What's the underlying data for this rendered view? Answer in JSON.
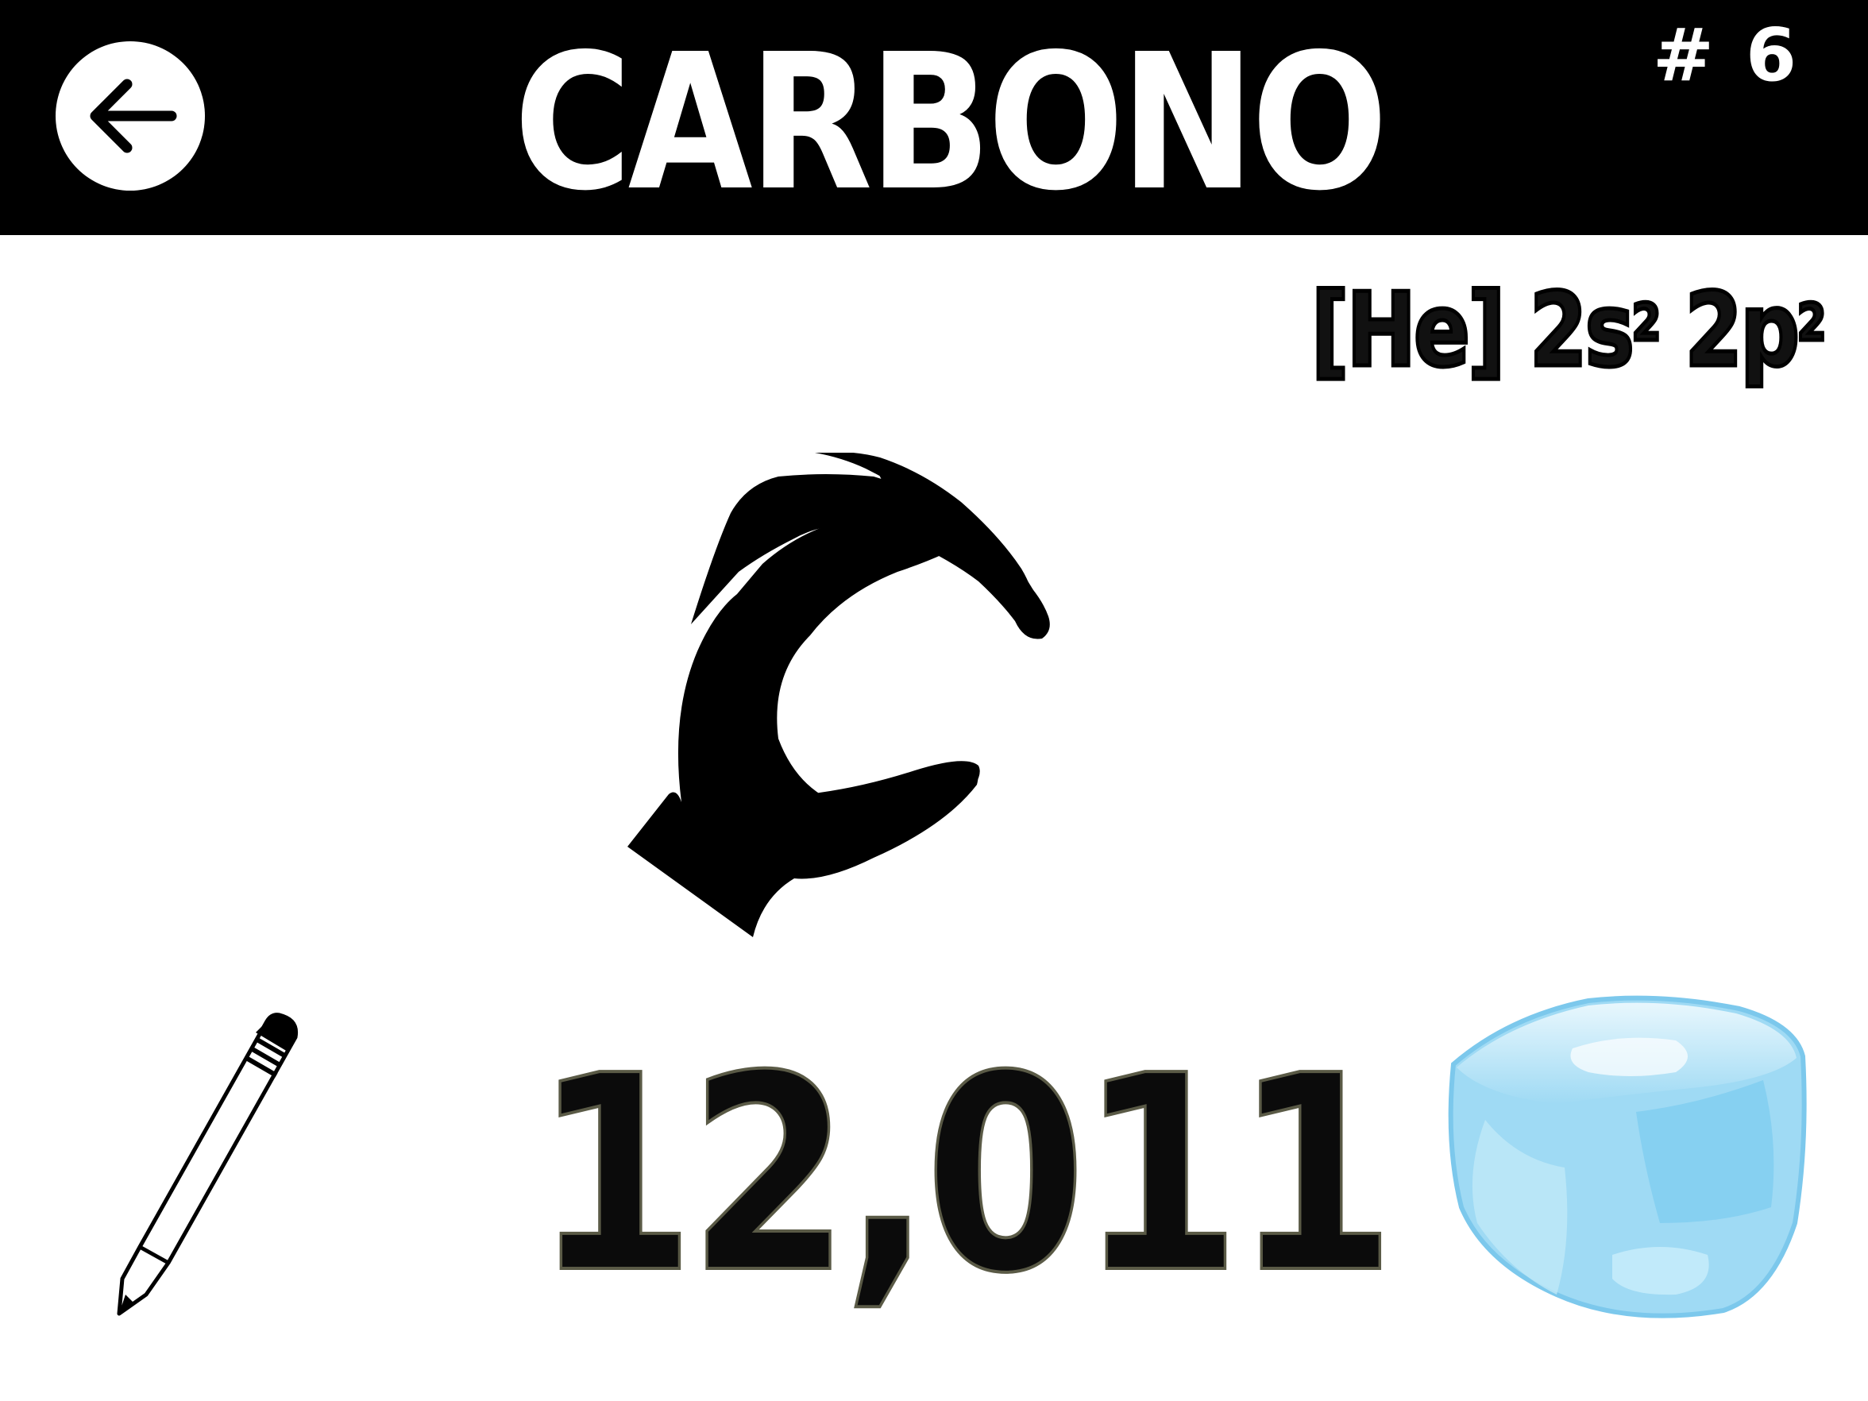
{
  "header": {
    "title": "CARBONO",
    "element_number": "# 6",
    "back_icon": "arrow-left-icon"
  },
  "electron_config": {
    "core": "[He]",
    "orbital_1": "2s",
    "orbital_1_exp": "2",
    "orbital_2": "2p",
    "orbital_2_exp": "2"
  },
  "illustration": {
    "sign_icon": "hand-sign-c-icon"
  },
  "atomic_mass": "12,011",
  "state": {
    "icon": "ice-cube-icon"
  },
  "tool": {
    "icon": "pencil-icon"
  },
  "colors": {
    "header_bg": "#000000",
    "header_text": "#ffffff",
    "ice": "#8fd3f2"
  }
}
